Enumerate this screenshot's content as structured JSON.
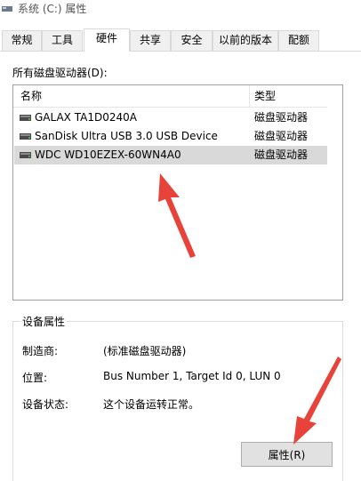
{
  "window": {
    "title": "系统 (C:) 属性"
  },
  "tabs": [
    {
      "label": "常规"
    },
    {
      "label": "工具"
    },
    {
      "label": "硬件",
      "active": true
    },
    {
      "label": "共享"
    },
    {
      "label": "安全"
    },
    {
      "label": "以前的版本"
    },
    {
      "label": "配额"
    }
  ],
  "hardware": {
    "drives_label": "所有磁盘驱动器(D):",
    "columns": {
      "name": "名称",
      "type": "类型"
    },
    "drives": [
      {
        "name": "GALAX TA1D0240A",
        "type": "磁盘驱动器"
      },
      {
        "name": "SanDisk Ultra USB 3.0 USB Device",
        "type": "磁盘驱动器"
      },
      {
        "name": "WDC WD10EZEX-60WN4A0",
        "type": "磁盘驱动器",
        "selected": true
      }
    ],
    "device_properties": {
      "title": "设备属性",
      "manufacturer_label": "制造商:",
      "manufacturer_value": "(标准磁盘驱动器)",
      "location_label": "位置:",
      "location_value": "Bus Number 1, Target Id 0, LUN 0",
      "status_label": "设备状态:",
      "status_value": "这个设备运转正常。"
    },
    "properties_button": "属性(R)"
  },
  "colors": {
    "selection": "#d9d9d9",
    "annotation_arrow": "#e8433a"
  }
}
